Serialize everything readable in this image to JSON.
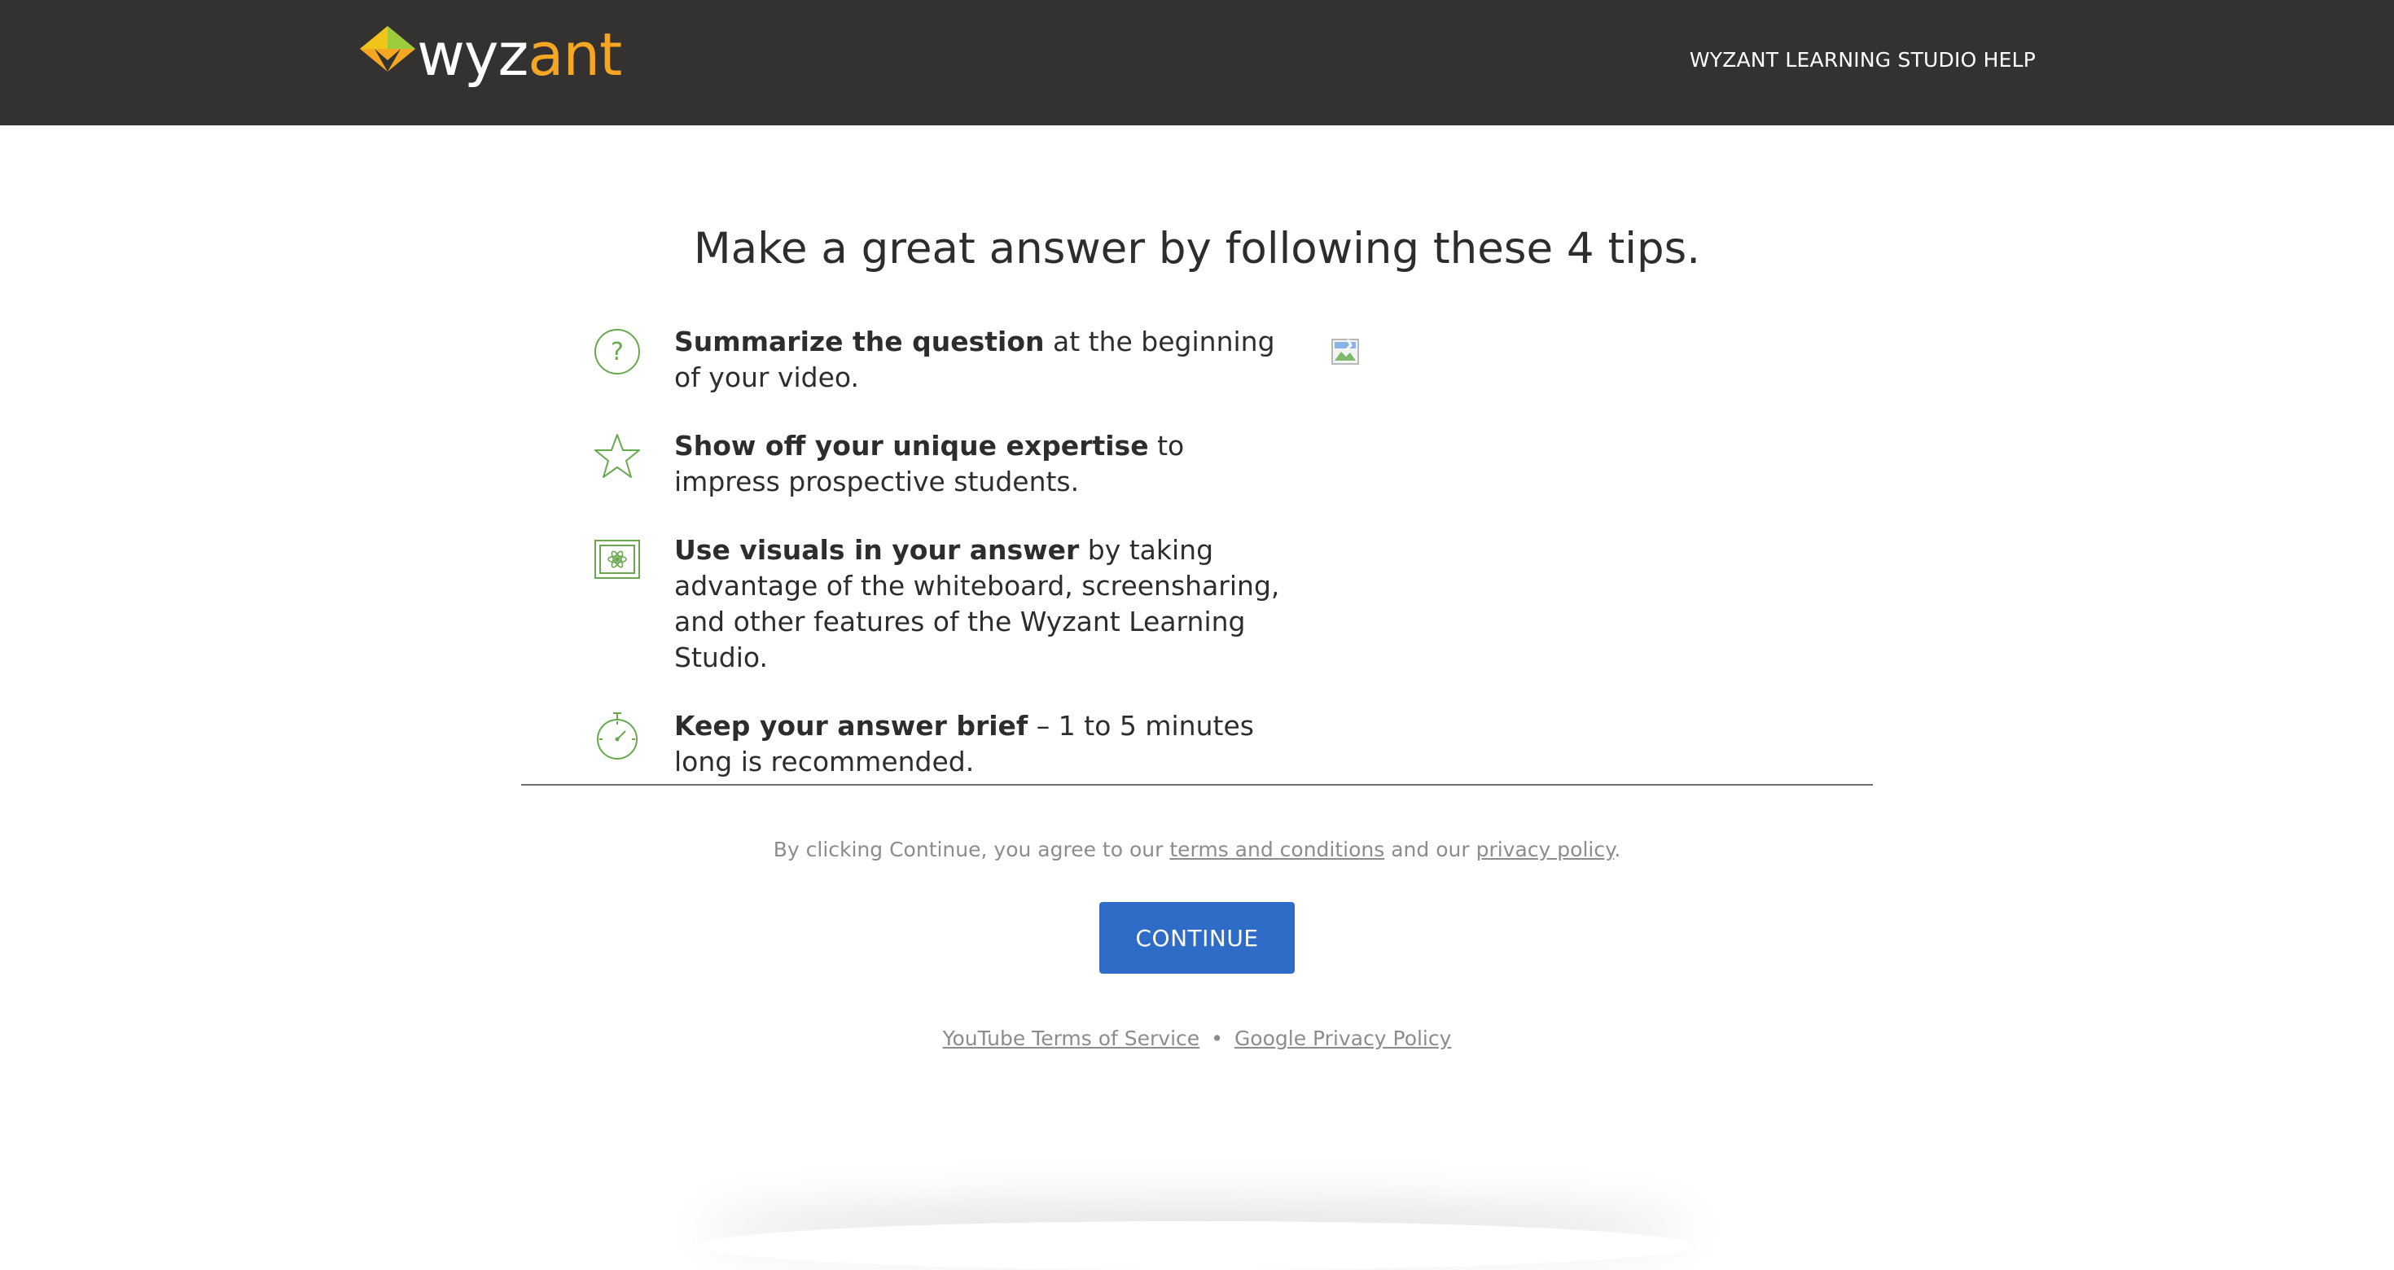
{
  "header": {
    "logo_text_white": "wyz",
    "logo_text_orange": "ant",
    "help_link": "WYZANT LEARNING STUDIO HELP"
  },
  "main": {
    "title": "Make a great answer by following these 4 tips.",
    "tips": [
      {
        "icon": "question-circle-icon",
        "bold": "Summarize the question",
        "rest": " at the beginning of your video."
      },
      {
        "icon": "star-icon",
        "bold": "Show off your unique expertise",
        "rest": " to impress prospective students."
      },
      {
        "icon": "whiteboard-icon",
        "bold": "Use visuals in your answer",
        "rest": " by taking advantage of the whiteboard, screensharing, and other features of the Wyzant Learning Studio."
      },
      {
        "icon": "stopwatch-icon",
        "bold": "Keep your answer brief",
        "rest": " – 1 to 5 minutes long is recommended."
      }
    ]
  },
  "agreement": {
    "prefix": "By clicking Continue, you agree to our ",
    "terms_link": "terms and conditions",
    "middle": " and our ",
    "privacy_link": "privacy policy",
    "suffix": "."
  },
  "continue_label": "CONTINUE",
  "footer": {
    "youtube_tos": "YouTube Terms of Service",
    "separator": "•",
    "google_privacy": "Google Privacy Policy"
  },
  "colors": {
    "header_bg": "#333231",
    "accent_green": "#6aa84f",
    "brand_orange": "#f5a623",
    "button_blue": "#2f6cc8"
  }
}
